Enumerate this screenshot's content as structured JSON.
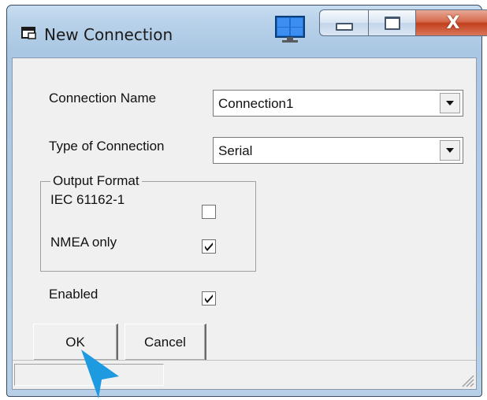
{
  "window": {
    "title": "New Connection",
    "controls": {
      "minimize": "minimize",
      "maximize": "maximize",
      "close": "X"
    }
  },
  "form": {
    "connection_name": {
      "label": "Connection Name",
      "value": "Connection1"
    },
    "type_of_connection": {
      "label": "Type of Connection",
      "value": "Serial"
    },
    "output_format": {
      "title": "Output Format",
      "options": [
        {
          "label": "IEC 61162-1",
          "checked": false
        },
        {
          "label": "NMEA only",
          "checked": true
        }
      ]
    },
    "enabled": {
      "label": "Enabled",
      "checked": true
    }
  },
  "buttons": {
    "ok": "OK",
    "cancel": "Cancel"
  },
  "status": {
    "text": ""
  },
  "colors": {
    "title_bar": "#b9d2ea",
    "client_bg": "#f0f0f0",
    "close_button": "#c3401e",
    "cursor": "#1e9be0"
  }
}
